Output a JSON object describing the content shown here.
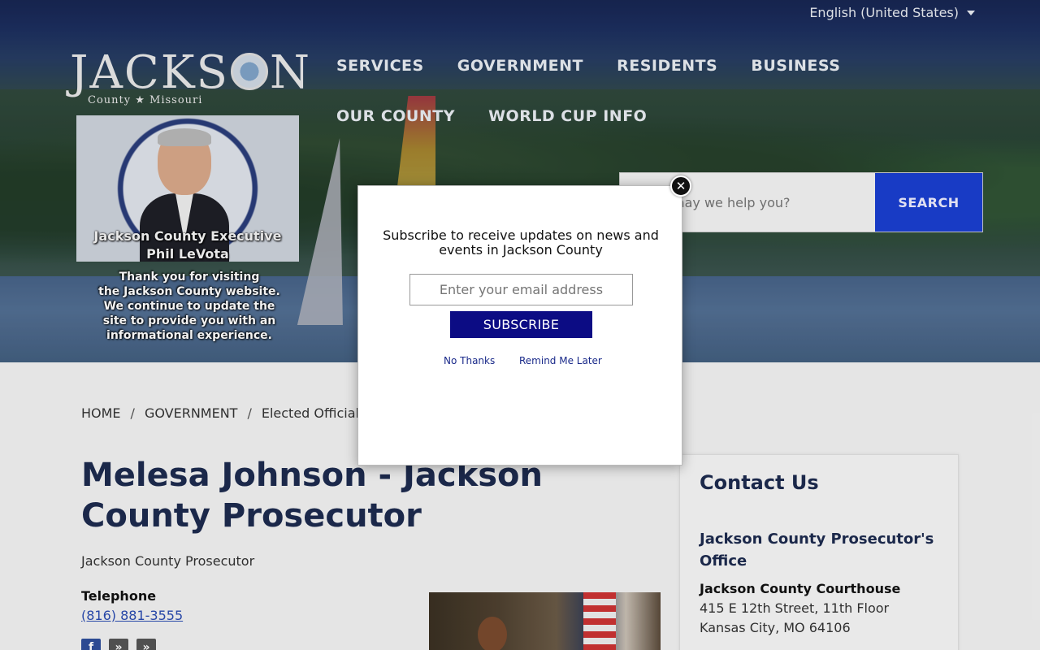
{
  "header": {
    "language": "English (United States)",
    "logo": {
      "word": "JACKSON",
      "subtitle": "County ★ Missouri"
    },
    "nav": [
      "SERVICES",
      "GOVERNMENT",
      "RESIDENTS",
      "BUSINESS",
      "OUR COUNTY",
      "WORLD CUP INFO"
    ],
    "exec_card": {
      "caption_line1": "Jackson County Executive",
      "caption_line2": "Phil LeVota",
      "thanks_line1": "Thank you for visiting",
      "thanks_line2": "the Jackson County website.",
      "thanks_line3": "We continue to update the",
      "thanks_line4": "site to provide you with an",
      "thanks_line5": "informational experience."
    },
    "search": {
      "placeholder": "How may we help you?",
      "button": "SEARCH"
    }
  },
  "breadcrumb": [
    "HOME",
    "GOVERNMENT",
    "Elected Officials"
  ],
  "page": {
    "title": "Melesa Johnson - Jackson County Prosecutor",
    "subtitle": "Jackson County Prosecutor",
    "telephone_label": "Telephone",
    "telephone": "(816) 881-3555"
  },
  "contact": {
    "heading": "Contact Us",
    "office": "Jackson County Prosecutor's Office",
    "building": "Jackson County Courthouse",
    "address_line1": "415 E 12th Street, 11th Floor",
    "address_line2": "Kansas City, MO 64106"
  },
  "modal": {
    "message": "Subscribe to receive updates on news and events in Jackson County",
    "email_placeholder": "Enter your email address",
    "subscribe": "SUBSCRIBE",
    "no_thanks": "No Thanks",
    "remind_later": "Remind Me Later",
    "close_icon": "close-icon"
  },
  "colors": {
    "nav_text": "#e8ecf2",
    "search_button": "#1a3fd0",
    "subscribe_button": "#0c0c84",
    "heading": "#1d2b4f",
    "link": "#2a4bb0"
  }
}
